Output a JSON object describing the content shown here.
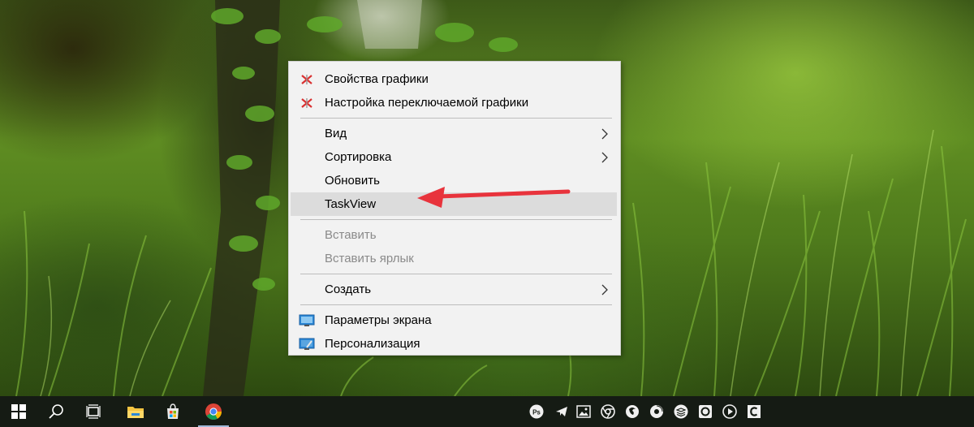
{
  "context_menu": {
    "items": [
      {
        "label": "Свойства графики",
        "icon": "intel-graphics-icon",
        "enabled": true
      },
      {
        "label": "Настройка переключаемой графики",
        "icon": "intel-graphics-icon",
        "enabled": true
      },
      {
        "label": "Вид",
        "submenu": true,
        "enabled": true
      },
      {
        "label": "Сортировка",
        "submenu": true,
        "enabled": true
      },
      {
        "label": "Обновить",
        "enabled": true
      },
      {
        "label": "TaskView",
        "enabled": true,
        "highlighted": true
      },
      {
        "label": "Вставить",
        "enabled": false
      },
      {
        "label": "Вставить ярлык",
        "enabled": false
      },
      {
        "label": "Создать",
        "submenu": true,
        "enabled": true
      },
      {
        "label": "Параметры экрана",
        "icon": "display-settings-icon",
        "enabled": true
      },
      {
        "label": "Персонализация",
        "icon": "personalization-icon",
        "enabled": true
      }
    ]
  },
  "annotation": {
    "color": "#e8333c",
    "icon": "red-arrow"
  },
  "taskbar": {
    "buttons": [
      {
        "name": "start-button",
        "icon": "windows-logo-icon"
      },
      {
        "name": "search-button",
        "icon": "search-icon"
      },
      {
        "name": "task-view-button",
        "icon": "task-view-icon"
      },
      {
        "name": "file-explorer-button",
        "icon": "folder-icon"
      },
      {
        "name": "store-button",
        "icon": "store-bag-icon"
      },
      {
        "name": "chrome-button",
        "icon": "chrome-icon",
        "active": true
      }
    ],
    "tray_icons": [
      "photoshop-icon",
      "telegram-icon",
      "photos-icon",
      "chrome-tray-icon",
      "firefox-icon",
      "cd-disc-icon",
      "layers-stack-icon",
      "circle-app-icon",
      "play-icon",
      "c-app-icon"
    ],
    "colors": {
      "background": "#151b14",
      "active_indicator": "#9fb8d8"
    }
  },
  "colors": {
    "menu_bg": "#f2f2f2",
    "menu_highlight": "#dcdcdc",
    "disabled_text": "#8a8a8a"
  }
}
